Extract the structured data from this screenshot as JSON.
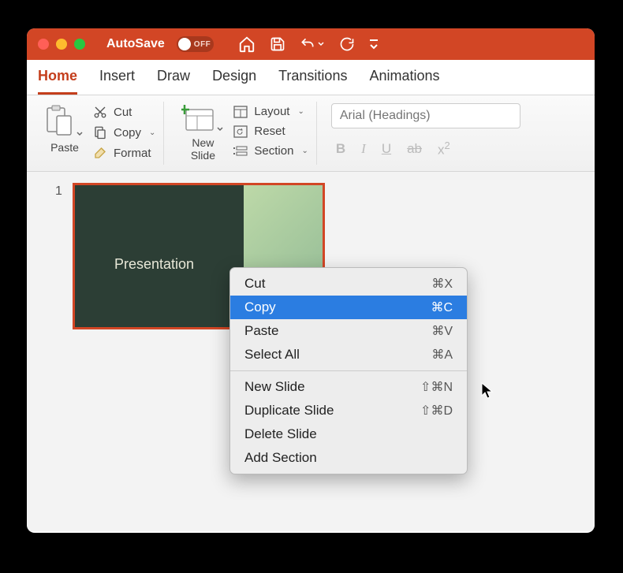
{
  "titlebar": {
    "autosave_label": "AutoSave",
    "autosave_state": "OFF"
  },
  "tabs": [
    "Home",
    "Insert",
    "Draw",
    "Design",
    "Transitions",
    "Animations"
  ],
  "active_tab": "Home",
  "ribbon": {
    "paste_label": "Paste",
    "cut_label": "Cut",
    "copy_label": "Copy",
    "format_label": "Format",
    "new_slide_label": "New\nSlide",
    "layout_label": "Layout",
    "reset_label": "Reset",
    "section_label": "Section",
    "font_placeholder": "Arial (Headings)"
  },
  "slide": {
    "number": "1",
    "title": "Presentation"
  },
  "context_menu": {
    "items": [
      {
        "label": "Cut",
        "shortcut": "⌘X"
      },
      {
        "label": "Copy",
        "shortcut": "⌘C",
        "highlighted": true
      },
      {
        "label": "Paste",
        "shortcut": "⌘V"
      },
      {
        "label": "Select All",
        "shortcut": "⌘A"
      }
    ],
    "items2": [
      {
        "label": "New Slide",
        "shortcut": "⇧⌘N"
      },
      {
        "label": "Duplicate Slide",
        "shortcut": "⇧⌘D"
      },
      {
        "label": "Delete Slide",
        "shortcut": ""
      },
      {
        "label": "Add Section",
        "shortcut": ""
      }
    ]
  }
}
